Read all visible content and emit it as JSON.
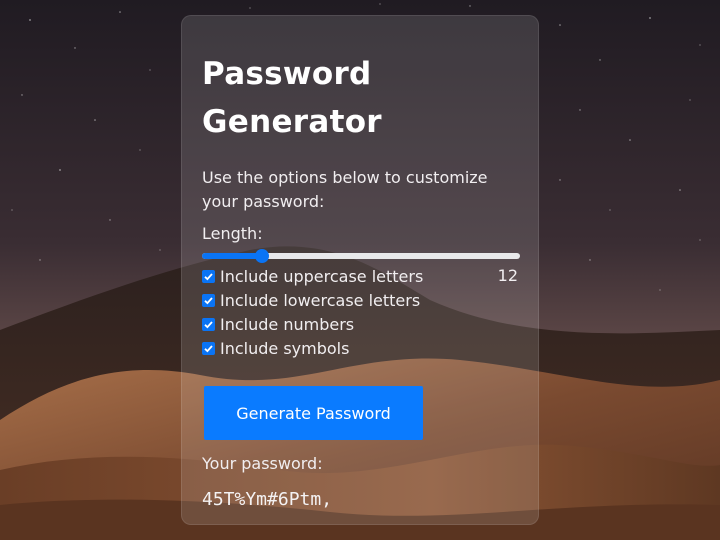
{
  "generator": {
    "title": "Password Generator",
    "description": "Use the options below to customize your password:",
    "length_label": "Length:",
    "length_value": "12",
    "length_fraction": 0.19,
    "options": [
      {
        "label": "Include uppercase letters",
        "checked": true
      },
      {
        "label": "Include lowercase letters",
        "checked": true
      },
      {
        "label": "Include numbers",
        "checked": true
      },
      {
        "label": "Include symbols",
        "checked": true
      }
    ],
    "button_label": "Generate Password",
    "result_label": "Your password:",
    "result_value": "45T%Ym#6Ptm,"
  },
  "colors": {
    "accent": "#0a7bff",
    "text": "#ffffff"
  },
  "icons": {
    "checkbox": "check-icon"
  }
}
